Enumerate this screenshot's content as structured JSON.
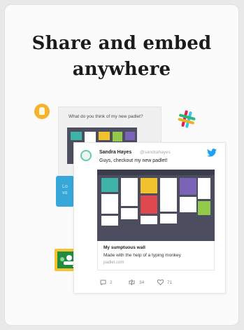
{
  "headline": {
    "line1": "Share and embed",
    "line2": "anywhere"
  },
  "background_post": {
    "question": "What do you think of my new padlet?"
  },
  "tweet": {
    "name": "Sandra Hayes",
    "handle": "@sandrahayes",
    "text": "Guys, checkout my new padlet!",
    "link_title": "My sumptuous wall",
    "link_subtitle": "Made with the help of a typing monkey",
    "link_url": "padlet.com",
    "replies": "2",
    "retweets": "34",
    "likes": "71"
  },
  "icons": {
    "avatar_app": "google-meet-icon",
    "slack": "slack-icon",
    "cyan_app": "cyan-app-icon",
    "classroom": "google-classroom-icon",
    "twitter": "twitter-bird-icon"
  },
  "colors": {
    "board_bg": "#4c4e5f",
    "twitter_blue": "#1da1f2",
    "classroom_green": "#1e8e3e",
    "accent_teal": "#6ccaa4"
  }
}
